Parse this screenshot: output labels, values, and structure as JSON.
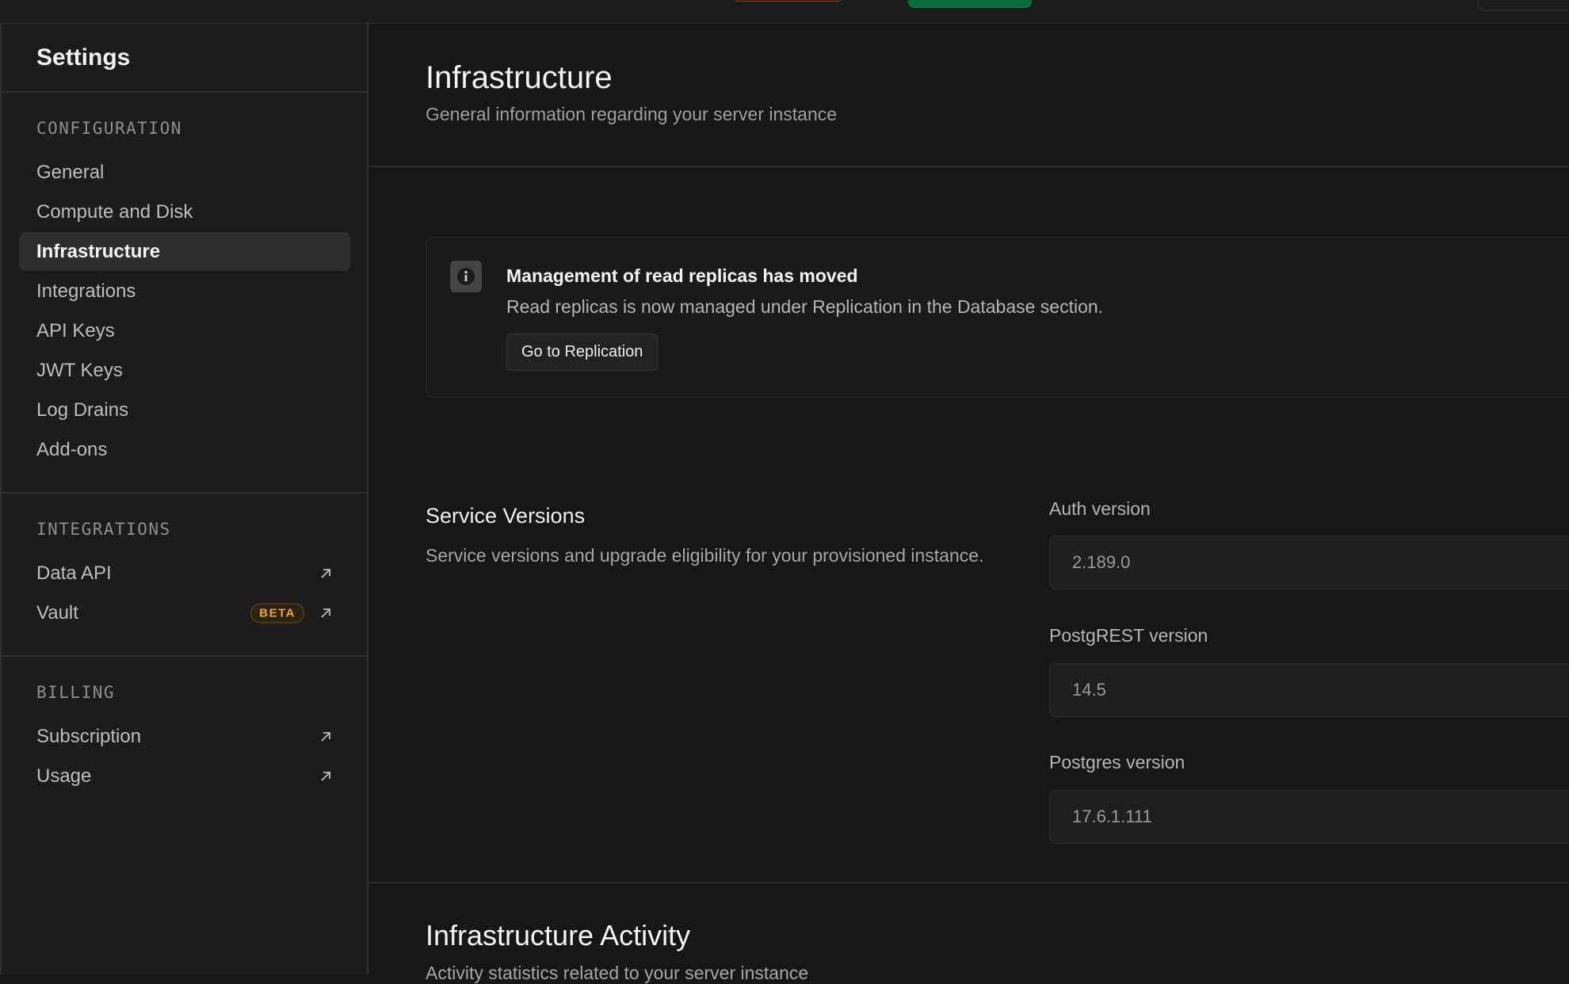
{
  "sidebar": {
    "title": "Settings",
    "sections": [
      {
        "title": "CONFIGURATION",
        "items": [
          {
            "label": "General"
          },
          {
            "label": "Compute and Disk"
          },
          {
            "label": "Infrastructure",
            "active": true
          },
          {
            "label": "Integrations"
          },
          {
            "label": "API Keys"
          },
          {
            "label": "JWT Keys"
          },
          {
            "label": "Log Drains"
          },
          {
            "label": "Add-ons"
          }
        ]
      },
      {
        "title": "INTEGRATIONS",
        "items": [
          {
            "label": "Data API",
            "icon": "external-link-icon"
          },
          {
            "label": "Vault",
            "badge": "BETA",
            "icon": "external-link-icon"
          }
        ]
      },
      {
        "title": "BILLING",
        "items": [
          {
            "label": "Subscription",
            "icon": "external-link-icon"
          },
          {
            "label": "Usage",
            "icon": "external-link-icon"
          }
        ]
      }
    ]
  },
  "page": {
    "title": "Infrastructure",
    "subtitle": "General information regarding your server instance"
  },
  "callout": {
    "icon": "info-icon",
    "title": "Management of read replicas has moved",
    "body": "Read replicas is now managed under Replication in the Database section.",
    "button_label": "Go to Replication"
  },
  "service_versions": {
    "title": "Service Versions",
    "description": "Service versions and upgrade eligibility for your provisioned instance.",
    "fields": [
      {
        "label": "Auth version",
        "value": "2.189.0"
      },
      {
        "label": "PostgREST version",
        "value": "14.5"
      },
      {
        "label": "Postgres version",
        "value": "17.6.1.111"
      }
    ]
  },
  "infrastructure_activity": {
    "title": "Infrastructure Activity",
    "subtitle": "Activity statistics related to your server instance"
  },
  "colors": {
    "background": "#171717",
    "sidebar": "#1c1c1c",
    "active_item": "#2e2e2e",
    "beta_badge": "#e7a83a",
    "brand_green": "#0b6b3a"
  }
}
